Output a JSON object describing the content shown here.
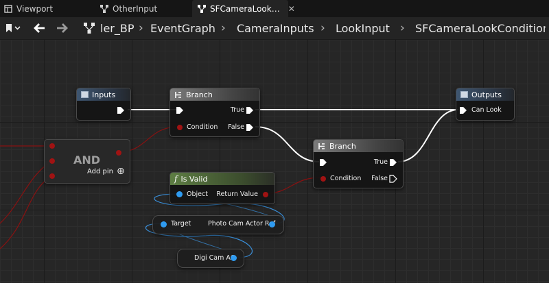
{
  "tabs": [
    {
      "label": "Viewport",
      "icon": "viewport-icon"
    },
    {
      "label": "OtherInput",
      "icon": "graph-icon"
    },
    {
      "label": "SFCameraLook…",
      "icon": "graph-icon",
      "active": true,
      "close": "✕"
    }
  ],
  "breadcrumb": [
    "ler_BP",
    "EventGraph",
    "CameraInputs",
    "LookInput",
    "SFCameraLookCondition"
  ],
  "breadcrumb_sep": "›",
  "nodes": {
    "inputs": {
      "title": "Inputs"
    },
    "outputs": {
      "title": "Outputs",
      "pin": "Can Look"
    },
    "branch1": {
      "title": "Branch",
      "condition": "Condition",
      "true": "True",
      "false": "False"
    },
    "branch2": {
      "title": "Branch",
      "condition": "Condition",
      "true": "True",
      "false": "False"
    },
    "and": {
      "title": "AND",
      "add_pin": "Add pin",
      "add_icon": "⊕"
    },
    "isvalid": {
      "title": "Is Valid",
      "func_icon": "f",
      "object": "Object",
      "return": "Return Value"
    },
    "photocam": {
      "target": "Target",
      "label": "Photo Cam Actor Ref"
    },
    "digicam": {
      "label": "Digi Cam AC"
    }
  },
  "colors": {
    "exec": "#ffffff",
    "bool_pin": "#a01313",
    "object_pin": "#2f9bf0",
    "object_wire": "#3a8fd9"
  }
}
